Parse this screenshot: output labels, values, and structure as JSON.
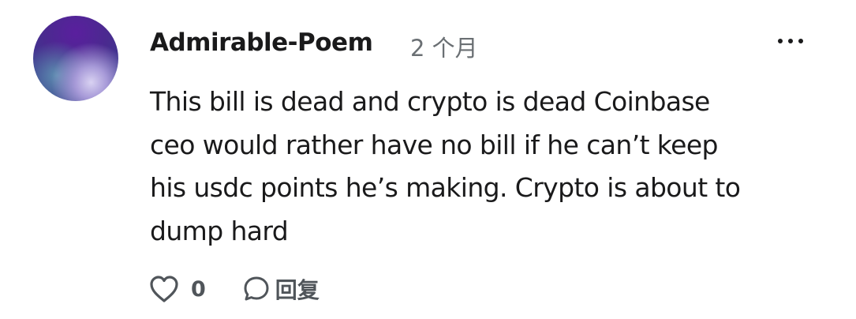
{
  "comment": {
    "author": "Admirable-Poem",
    "time_ago": "2 个月",
    "body_lines": [
      "This bill is dead and crypto is dead Coinbase",
      "ceo would rather have no bill if he can’t keep",
      "his usdc points he’s making. Crypto is about to",
      "dump hard"
    ],
    "likes": "0",
    "reply_label": "回复",
    "avatar_icon": "user-avatar",
    "more_icon": "more-options-icon",
    "like_icon": "heart-icon",
    "reply_icon": "speech-bubble-icon"
  }
}
